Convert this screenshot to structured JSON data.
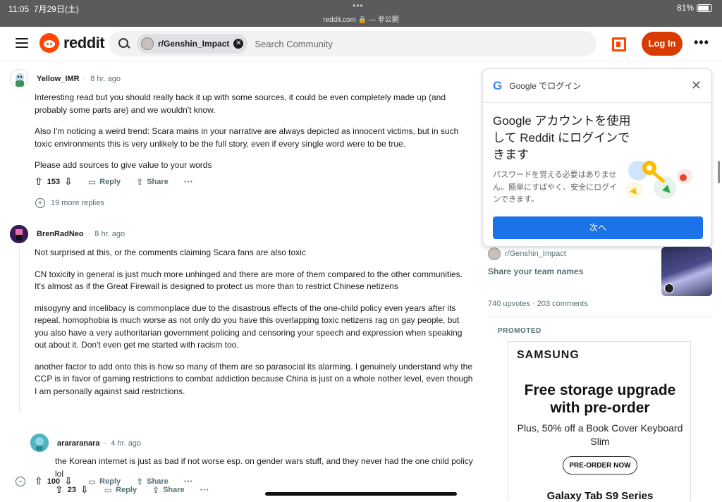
{
  "status_bar": {
    "time": "11:05",
    "date": "7月29日(土)",
    "dots": "•••",
    "url": "reddit.com 🔒 — 非公開",
    "battery": "81%",
    "battery_level": 0.81
  },
  "header": {
    "logo_text": "reddit",
    "search_chip": "r/Genshin_Impact",
    "search_placeholder": "Search Community",
    "login_label": "Log In",
    "more_label": "•••"
  },
  "comments": [
    {
      "user": "Yellow_IMR",
      "time": "8 hr. ago",
      "avatar_color": "#5a9bd5",
      "paragraphs": [
        "Interesting read but you should really back it up with some sources, it could be even completely made up (and probably some parts are) and we wouldn't know.",
        "Also I'm noticing a weird trend: Scara mains in your narrative are always depicted as innocent victims, but in such toxic environments this is very unlikely to be the full story, even if every single word were to be true.",
        "Please add sources to give value to your words"
      ],
      "votes": "153",
      "reply": "Reply",
      "share": "Share",
      "more_replies": "19 more replies"
    },
    {
      "user": "BrenRadNeo",
      "time": "8 hr. ago",
      "avatar_color": "#6b2fa0",
      "paragraphs": [
        "Not surprised at this, or the comments claiming Scara fans are also toxic",
        "CN toxicity in general is just much more unhinged and there are more of them compared to the other communities. It's almost as if the Great Firewall is designed to protect us more than to restrict Chinese netizens",
        "misogyny and incelibacy is commonplace due to the disastrous effects of the one-child policy even years after its repeal. homophobia is much worse as not only do you have this overlapping toxic netizens rag on gay people, but you also have a very authoritarian government policing and censoring your speech and expression when speaking out about it. Don't even get me started with racism too.",
        "another factor to add onto this is how so many of them are so parasocial its alarming. I genuinely understand why the CCP is in favor of gaming restrictions to combat addiction because China is just on a whole nother level, even though I am personally against said restrictions."
      ],
      "votes": "100",
      "reply": "Reply",
      "share": "Share"
    },
    {
      "user": "arararanara",
      "time": "4 hr. ago",
      "avatar_color": "#4fb3c4",
      "paragraphs": [
        "the Korean internet is just as bad if not worse esp. on gender wars stuff, and they never had the one child policy lol"
      ],
      "votes": "23",
      "reply": "Reply",
      "share": "Share"
    }
  ],
  "google_login": {
    "header": "Google でログイン",
    "logo": "G",
    "title": "Google アカウントを使用して Reddit にログインできます",
    "description": "パスワードを覚える必要はありません。簡単にすばやく、安全にログインできます。",
    "button": "次へ"
  },
  "related_post": {
    "subreddit": "r/Genshin_Impact",
    "title": "Share your team names",
    "stats": "740 upvotes · 203 comments"
  },
  "promoted": {
    "label": "PROMOTED",
    "brand": "SAMSUNG",
    "headline": "Free storage upgrade with pre-order",
    "sub": "Plus, 50% off a Book Cover Keyboard Slim",
    "cta": "PRE-ORDER NOW",
    "footer": "Galaxy Tab S9 Series"
  }
}
